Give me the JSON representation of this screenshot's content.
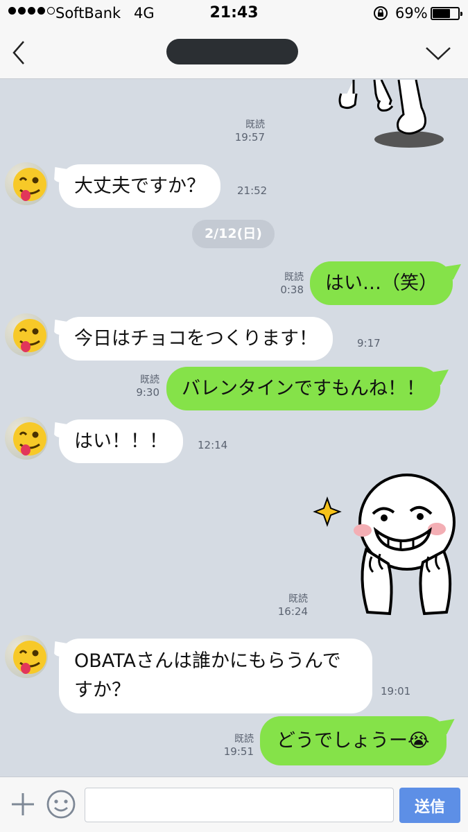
{
  "status_bar": {
    "carrier": "SoftBank",
    "network": "4G",
    "time": "21:43",
    "battery_percent": "69%",
    "battery_level": 0.69,
    "signal_dots_filled": 4,
    "signal_dots_total": 5
  },
  "nav": {
    "title": "",
    "back_icon": "chevron-left-icon",
    "menu_icon": "chevron-down-icon"
  },
  "messages": [
    {
      "side": "out",
      "type": "sticker",
      "read": "既読",
      "time": "19:57"
    },
    {
      "side": "in",
      "text": "大丈夫ですか？",
      "time": "21:52"
    },
    {
      "side": "date",
      "text": "2/12(日)"
    },
    {
      "side": "out",
      "text": "はい…（笑）",
      "read": "既読",
      "time": "0:38"
    },
    {
      "side": "in",
      "text": "今日はチョコをつくります！",
      "time": "9:17"
    },
    {
      "side": "out",
      "text": "バレンタインですもんね！！",
      "read": "既読",
      "time": "9:30"
    },
    {
      "side": "in",
      "text": "はい！！！",
      "time": "12:14"
    },
    {
      "side": "out",
      "type": "sticker",
      "read": "既読",
      "time": "16:24"
    },
    {
      "side": "in",
      "text": "OBATAさんは誰かにもらうんですか？",
      "time": "19:01"
    },
    {
      "side": "out",
      "text": "どうでしょうー😭",
      "read": "既読",
      "time": "19:51"
    }
  ],
  "input_bar": {
    "placeholder": "",
    "send_label": "送信"
  },
  "colors": {
    "chat_background": "#d5dbe3",
    "outgoing_bubble": "#85e249",
    "incoming_bubble": "#ffffff",
    "send_button": "#5d8fe6"
  }
}
